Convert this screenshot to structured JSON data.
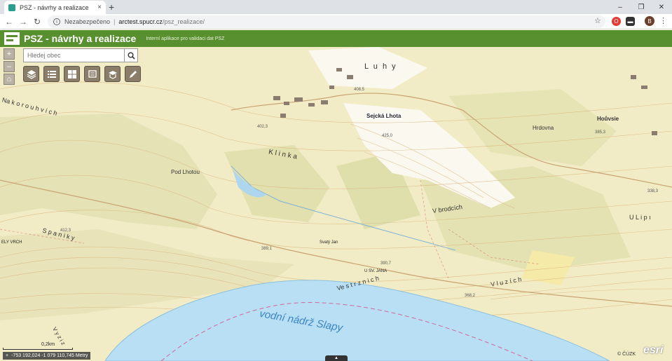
{
  "browser": {
    "tab_title": "PSZ - návrhy a realizace",
    "tab_close": "×",
    "new_tab": "+",
    "security_label": "Nezabezpečeno",
    "url_host": "arctest.spucr.cz",
    "url_path": "/psz_realizace/",
    "avatar_initial": "B",
    "controls": {
      "minimize": "–",
      "restore": "❐",
      "close": "✕"
    }
  },
  "app": {
    "title": "PSZ - návrhy a realizace",
    "subtitle": "Interní aplikace pro validaci dat PSZ"
  },
  "map": {
    "search_placeholder": "Hledej obec",
    "tools": [
      "layers-icon",
      "list-icon",
      "grid-icon",
      "print-icon",
      "basemap-icon",
      "edit-icon"
    ],
    "labels": {
      "lake": "vodní nádrž Slapy",
      "village": "Sejcká Lhota",
      "luhy": "L u h y",
      "klinka": "K l i n k a",
      "pod_lhotou": "Pod Lhotou",
      "v_brodcich": "V brodcích",
      "v_luzich": "V l u z í c h",
      "ve_strznich": "Ve s t r z n i c h",
      "hrdovna": "Hrdovna",
      "hosvsie": "Hoůvsie",
      "spanky": "S p a n i k y",
      "v_lipi": "U L i p ı",
      "korouhvich": "Na k o r o u h v í c h",
      "svaty_jan": "Svatý Jan",
      "u_sv_jana": "U SV. JANA",
      "vyziz": "V y z i z",
      "skely_vrch": "ELY VRCH",
      "elev_1": "425,0",
      "elev_2": "402,3",
      "elev_3": "389,1",
      "elev_4": "390,7",
      "elev_5": "368,2",
      "elev_6": "385,3",
      "elev_7": "412,3",
      "elev_8": "408,5",
      "elev_9": "338,3"
    },
    "scale_label": "0,2km",
    "coordinates": "-753 192,024 -1 079 110,745 Metry",
    "coords_toggle": "+",
    "attribution": "© ČÚZK",
    "esri": "esri",
    "bottom_toggle": "▲"
  }
}
